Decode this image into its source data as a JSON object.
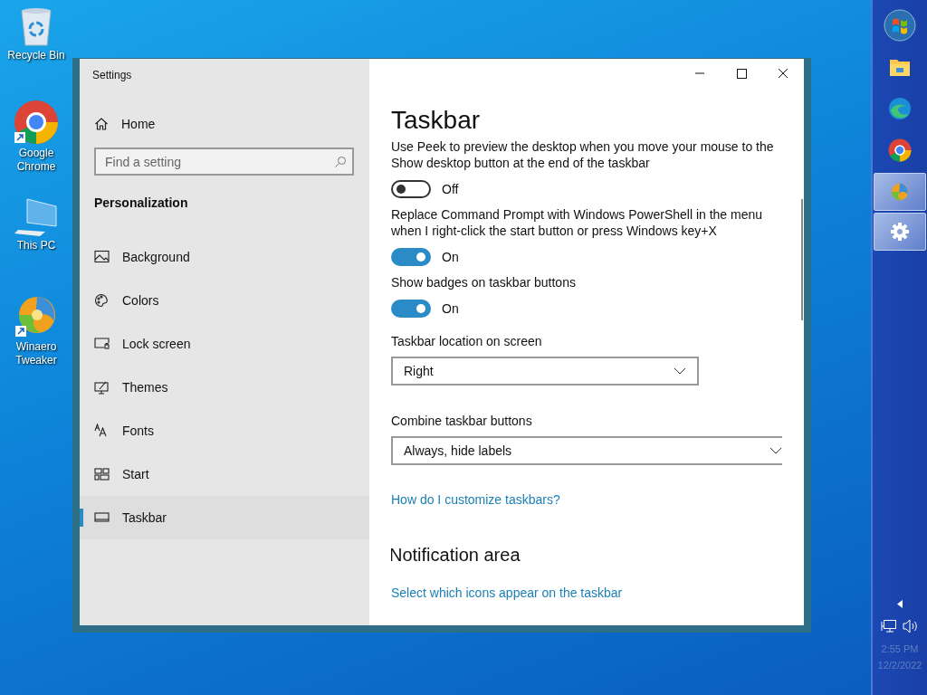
{
  "desktop_icons": [
    {
      "kind": "recycle",
      "label": "Recycle Bin"
    },
    {
      "kind": "chrome",
      "label": "Google Chrome"
    },
    {
      "kind": "pc",
      "label": "This PC"
    },
    {
      "kind": "winaero",
      "label": "Winaero Tweaker"
    }
  ],
  "window": {
    "title": "Settings"
  },
  "sidebar": {
    "home": "Home",
    "search": {
      "placeholder": "Find a setting"
    },
    "section": "Personalization",
    "items": [
      {
        "kind": "background",
        "label": "Background",
        "selected": false
      },
      {
        "kind": "colors",
        "label": "Colors",
        "selected": false
      },
      {
        "kind": "lock",
        "label": "Lock screen",
        "selected": false
      },
      {
        "kind": "themes",
        "label": "Themes",
        "selected": false
      },
      {
        "kind": "fonts",
        "label": "Fonts",
        "selected": false
      },
      {
        "kind": "start",
        "label": "Start",
        "selected": false
      },
      {
        "kind": "taskbar",
        "label": "Taskbar",
        "selected": true
      }
    ]
  },
  "content": {
    "title": "Taskbar",
    "settings": [
      {
        "kind": "toggle",
        "label": "Use Peek to preview the desktop when you move your mouse to the Show desktop button at the end of the taskbar",
        "on": false,
        "state_text": "Off"
      },
      {
        "kind": "toggle",
        "label": "Replace Command Prompt with Windows PowerShell in the menu when I right-click the start button or press Windows key+X",
        "on": true,
        "state_text": "On"
      },
      {
        "kind": "toggle",
        "label": "Show badges on taskbar buttons",
        "on": true,
        "state_text": "On"
      },
      {
        "kind": "dropdown",
        "label": "Taskbar location on screen",
        "value": "Right"
      },
      {
        "kind": "dropdown",
        "label": "Combine taskbar buttons",
        "value": "Always, hide labels"
      },
      {
        "kind": "link",
        "label": "How do I customize taskbars?"
      },
      {
        "kind": "heading",
        "label": "Notification area"
      },
      {
        "kind": "link",
        "label": "Select which icons appear on the taskbar"
      }
    ]
  },
  "taskbar": {
    "items": [
      {
        "kind": "start",
        "selected": false
      },
      {
        "kind": "explorer",
        "selected": false
      },
      {
        "kind": "edge",
        "selected": false
      },
      {
        "kind": "chrome",
        "selected": false
      },
      {
        "kind": "winaero",
        "selected": true
      },
      {
        "kind": "settings",
        "selected": true
      }
    ],
    "time": "2:55 PM",
    "date": "12/2/2022"
  }
}
